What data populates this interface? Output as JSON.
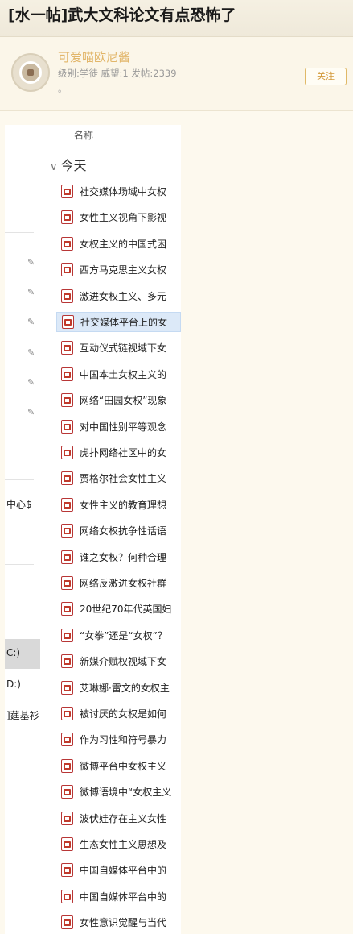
{
  "header": {
    "title": "[水一帖]武大文科论文有点恐怖了"
  },
  "user": {
    "name": "可爱喵欧尼酱",
    "info": "级别:学徒 威望:1 发帖:2339",
    "dot": "。",
    "follow_label": "关注"
  },
  "explorer": {
    "column_header": "名称",
    "group_label": "今天",
    "nav_labels": [
      "中心$",
      "C:)",
      "D:)",
      "]莛基衫"
    ],
    "selected_index": 5,
    "files": [
      "社交媒体场域中女权",
      "女性主义视角下影视",
      "女权主义的中国式困",
      "西方马克思主义女权",
      "激进女权主义、多元",
      "社交媒体平台上的女",
      "互动仪式链视域下女",
      "中国本土女权主义的",
      "网络“田园女权”现象",
      "对中国性别平等观念",
      "虎扑网络社区中的女",
      "贾格尔社会女性主义",
      "女性主义的教育理想",
      "网络女权抗争性话语",
      "谁之女权？何种合理",
      "网络反激进女权社群",
      "20世纪70年代英国妇",
      "“女拳”还是“女权”？_",
      "新媒介赋权视域下女",
      "艾琳娜·雷文的女权主",
      "被讨厌的女权是如何",
      "作为习性和符号暴力",
      "微博平台中女权主义",
      "微博语境中“女权主义",
      "波伏娃存在主义女性",
      "生态女性主义思想及",
      "中国自媒体平台中的",
      "中国自媒体平台中的",
      "女性意识觉醒与当代"
    ]
  }
}
